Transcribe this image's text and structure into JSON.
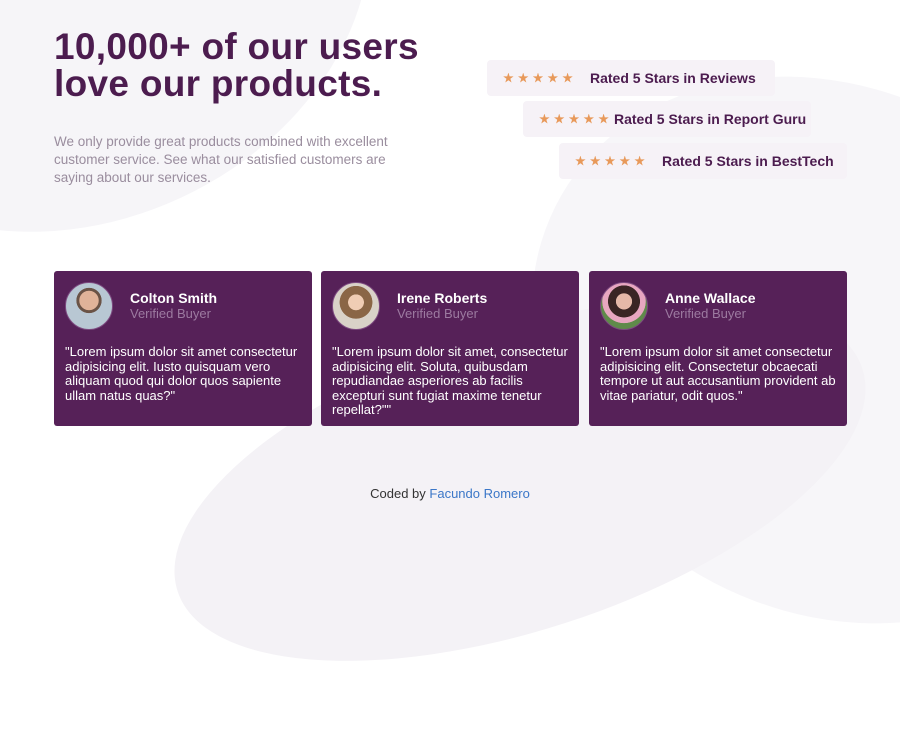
{
  "header": {
    "title_line1": "10,000+ of our users",
    "title_line2": "love our products.",
    "description": "We only provide great products combined with excellent customer service. See what our satisfied customers are saying about our services."
  },
  "ratings": [
    {
      "stars": 5,
      "label": "Rated 5 Stars in Reviews"
    },
    {
      "stars": 5,
      "label": "Rated 5 Stars in Report Guru"
    },
    {
      "stars": 5,
      "label": "Rated 5 Stars in BestTech"
    }
  ],
  "testimonials": [
    {
      "name": "Colton Smith",
      "badge": "Verified Buyer",
      "quote": "\"Lorem ipsum dolor sit amet consectetur adipisicing elit. Iusto quisquam vero aliquam quod qui dolor quos sapiente ullam natus quas?\""
    },
    {
      "name": "Irene Roberts",
      "badge": "Verified Buyer",
      "quote": "\"Lorem ipsum dolor sit amet, consectetur adipisicing elit. Soluta, quibusdam repudiandae asperiores ab facilis excepturi sunt fugiat maxime tenetur repellat?\"\""
    },
    {
      "name": "Anne Wallace",
      "badge": "Verified Buyer",
      "quote": "\"Lorem ipsum dolor sit amet consectetur adipisicing elit. Consectetur obcaecati tempore ut aut accusantium provident ab vitae pariatur, odit quos.\""
    }
  ],
  "footer": {
    "prefix": "Coded by",
    "author": "Facundo Romero"
  },
  "colors": {
    "accent": "#4c1c4f",
    "card": "#562158",
    "star": "#e8995a",
    "link": "#3b77c8"
  }
}
